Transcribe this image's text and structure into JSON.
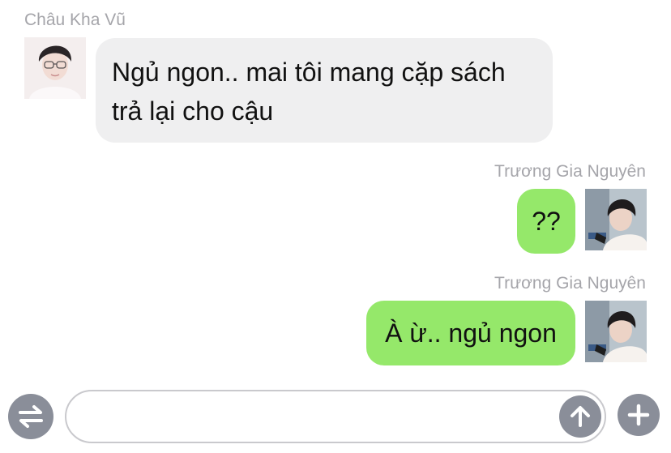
{
  "messages": [
    {
      "direction": "incoming",
      "sender": "Châu Kha Vũ",
      "lines": [
        "Ngủ ngon.. mai tôi mang cặp sách",
        "trả lại cho cậu"
      ]
    },
    {
      "direction": "outgoing",
      "sender": "Trương Gia Nguyên",
      "text": "??"
    },
    {
      "direction": "outgoing",
      "sender": "Trương Gia Nguyên",
      "text": "À ừ.. ngủ ngon"
    }
  ],
  "composer": {
    "input_value": "",
    "input_placeholder": "",
    "left_button_icon": "swap-arrows-icon",
    "send_button_icon": "arrow-up-icon",
    "right_button_icon": "plus-icon"
  },
  "colors": {
    "background": "#ffffff",
    "sender_name": "#a5a5aa",
    "incoming_bubble": "#efeff0",
    "outgoing_bubble": "#95e86a",
    "button_gray": "#8a8e99"
  }
}
